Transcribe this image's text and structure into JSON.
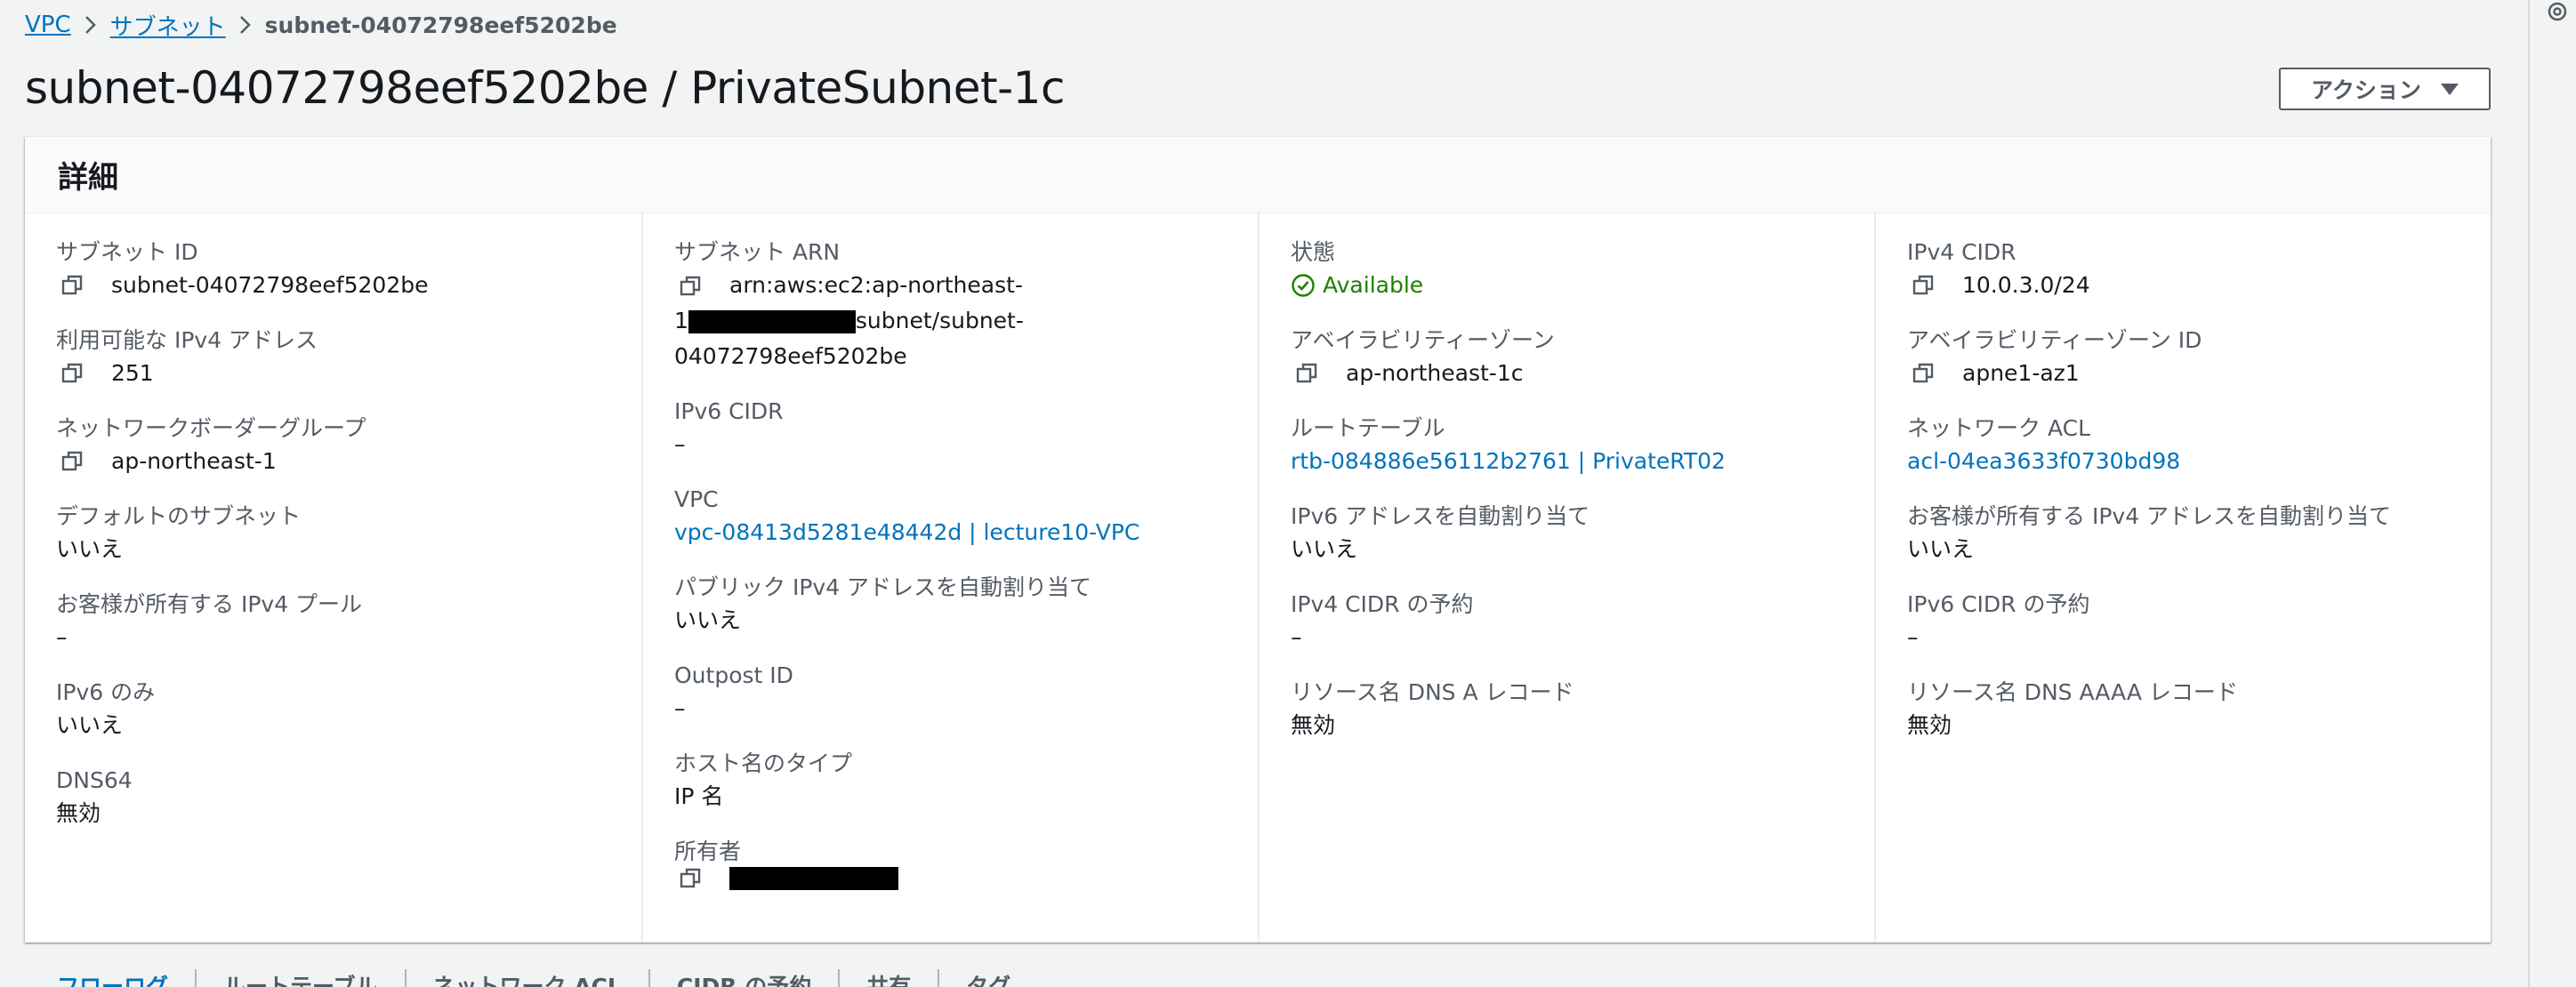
{
  "breadcrumb": {
    "vpc": "VPC",
    "subnets": "サブネット",
    "current": "subnet-04072798eef5202be"
  },
  "page": {
    "title": "subnet-04072798eef5202be / PrivateSubnet-1c"
  },
  "actions": {
    "label": "アクション"
  },
  "details": {
    "heading": "詳細",
    "col1": {
      "subnet_id_label": "サブネット ID",
      "subnet_id": "subnet-04072798eef5202be",
      "available_ipv4_label": "利用可能な IPv4 アドレス",
      "available_ipv4": "251",
      "nbg_label": "ネットワークボーダーグループ",
      "nbg": "ap-northeast-1",
      "default_subnet_label": "デフォルトのサブネット",
      "default_subnet": "いいえ",
      "owned_ipv4_pool_label": "お客様が所有する IPv4 プール",
      "owned_ipv4_pool": "–",
      "ipv6_only_label": "IPv6 のみ",
      "ipv6_only": "いいえ",
      "dns64_label": "DNS64",
      "dns64": "無効"
    },
    "col2": {
      "arn_label": "サブネット ARN",
      "arn_line1": "arn:aws:ec2:ap-northeast-",
      "arn_line2_prefix": "1",
      "arn_line2_suffix": "subnet/subnet-04072798eef5202be",
      "ipv6_cidr_label": "IPv6 CIDR",
      "ipv6_cidr": "–",
      "vpc_label": "VPC",
      "vpc": "vpc-08413d5281e48442d | lecture10-VPC",
      "auto_public_ipv4_label": "パブリック IPv4 アドレスを自動割り当て",
      "auto_public_ipv4": "いいえ",
      "outpost_label": "Outpost ID",
      "outpost": "–",
      "hostname_type_label": "ホスト名のタイプ",
      "hostname_type": "IP 名",
      "owner_label": "所有者"
    },
    "col3": {
      "state_label": "状態",
      "state": "Available",
      "az_label": "アベイラビリティーゾーン",
      "az": "ap-northeast-1c",
      "route_table_label": "ルートテーブル",
      "route_table": "rtb-084886e56112b2761 | PrivateRT02",
      "auto_ipv6_label": "IPv6 アドレスを自動割り当て",
      "auto_ipv6": "いいえ",
      "ipv4_reservation_label": "IPv4 CIDR の予約",
      "ipv4_reservation": "–",
      "dns_a_label": "リソース名 DNS A レコード",
      "dns_a": "無効"
    },
    "col4": {
      "ipv4_cidr_label": "IPv4 CIDR",
      "ipv4_cidr": "10.0.3.0/24",
      "az_id_label": "アベイラビリティーゾーン ID",
      "az_id": "apne1-az1",
      "nacl_label": "ネットワーク ACL",
      "nacl": "acl-04ea3633f0730bd98",
      "owned_ipv4_auto_label": "お客様が所有する IPv4 アドレスを自動割り当て",
      "owned_ipv4_auto": "いいえ",
      "ipv6_reservation_label": "IPv6 CIDR の予約",
      "ipv6_reservation": "–",
      "dns_aaaa_label": "リソース名 DNS AAAA レコード",
      "dns_aaaa": "無効"
    }
  },
  "tabs": [
    "フローログ",
    "ルートテーブル",
    "ネットワーク ACL",
    "CIDR の予約",
    "共有",
    "タグ"
  ],
  "colors": {
    "link": "#0073bb",
    "success": "#1d8102",
    "label": "#545b64",
    "text": "#16191f"
  },
  "icons": {
    "copy": "copy-icon",
    "status": "check-circle-icon",
    "caret": "caret-down-icon",
    "breadcrumb_sep": "chevron-right-icon"
  }
}
